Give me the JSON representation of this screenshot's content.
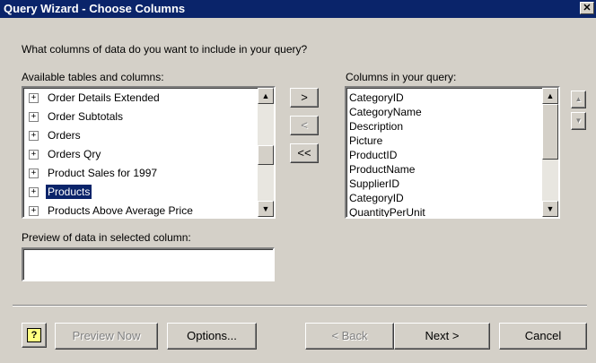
{
  "window": {
    "title": "Query Wizard - Choose Columns",
    "close_glyph": "✕"
  },
  "prompt": "What columns of data do you want to include in your query?",
  "available": {
    "label": "Available tables and columns:",
    "expand_glyph": "+",
    "items": [
      {
        "text": "Order Details Extended",
        "selected": false
      },
      {
        "text": "Order Subtotals",
        "selected": false
      },
      {
        "text": "Orders",
        "selected": false
      },
      {
        "text": "Orders Qry",
        "selected": false
      },
      {
        "text": "Product Sales for 1997",
        "selected": false
      },
      {
        "text": "Products",
        "selected": true
      },
      {
        "text": "Products Above Average Price",
        "selected": false
      }
    ]
  },
  "move_buttons": {
    "add": ">",
    "remove": "<",
    "remove_all": "<<"
  },
  "query_columns": {
    "label": "Columns in your query:",
    "items": [
      "CategoryID",
      "CategoryName",
      "Description",
      "Picture",
      "ProductID",
      "ProductName",
      "SupplierID",
      "CategoryID",
      "QuantityPerUnit"
    ]
  },
  "preview": {
    "label": "Preview of data in selected column:",
    "value": ""
  },
  "scroll_glyphs": {
    "up": "▲",
    "down": "▼"
  },
  "footer": {
    "help_glyph": "?",
    "preview_now": "Preview Now",
    "options": "Options...",
    "back": "< Back",
    "next": "Next >",
    "cancel": "Cancel"
  }
}
